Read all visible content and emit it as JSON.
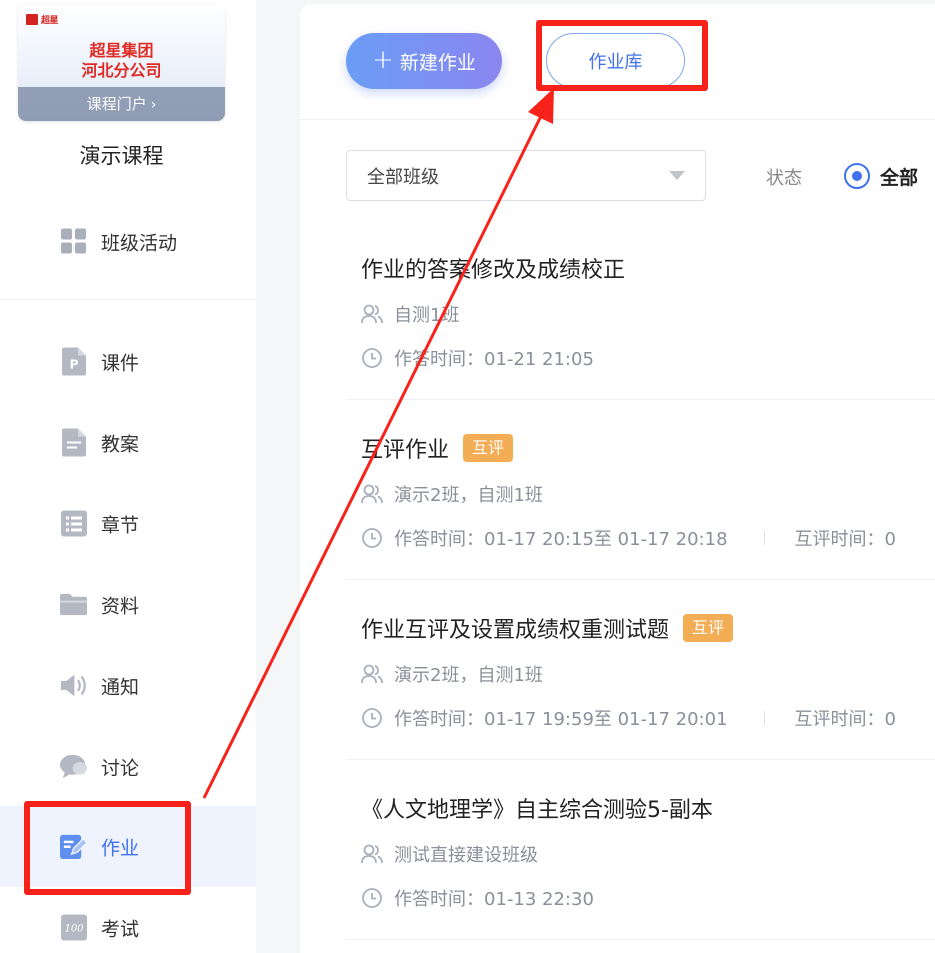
{
  "sidebar": {
    "logo_text": "超星",
    "org_line1": "超星集团",
    "org_line2": "河北分公司",
    "portal_label": "课程门户",
    "course_title": "演示课程",
    "items": [
      {
        "label": "班级活动",
        "icon": "grid-icon"
      },
      {
        "label": "课件",
        "icon": "ppt-file-icon"
      },
      {
        "label": "教案",
        "icon": "lesson-plan-icon"
      },
      {
        "label": "章节",
        "icon": "list-icon"
      },
      {
        "label": "资料",
        "icon": "folder-icon"
      },
      {
        "label": "通知",
        "icon": "speaker-icon"
      },
      {
        "label": "讨论",
        "icon": "chat-bubble-icon"
      },
      {
        "label": "作业",
        "icon": "edit-icon",
        "active": true
      },
      {
        "label": "考试",
        "icon": "score-100-icon"
      }
    ]
  },
  "toolbar": {
    "new_label": "新建作业",
    "library_label": "作业库"
  },
  "filter": {
    "class_selected": "全部班级",
    "status_label": "状态",
    "status_selected": "全部"
  },
  "homework": [
    {
      "title": "作业的答案修改及成绩校正",
      "badge": "",
      "classes": "自测1班",
      "time": "作答时间：01-21 21:05",
      "peer_time": ""
    },
    {
      "title": "互评作业",
      "badge": "互评",
      "classes": "演示2班，自测1班",
      "time": "作答时间：01-17 20:15至 01-17 20:18",
      "peer_time": "互评时间：0"
    },
    {
      "title": "作业互评及设置成绩权重测试题",
      "badge": "互评",
      "classes": "演示2班，自测1班",
      "time": "作答时间：01-17 19:59至 01-17 20:01",
      "peer_time": "互评时间：0"
    },
    {
      "title": "《人文地理学》自主综合测验5-副本",
      "badge": "",
      "classes": "测试直接建设班级",
      "time": "作答时间：01-13 22:30",
      "peer_time": ""
    }
  ],
  "colors": {
    "accent": "#3f72ec",
    "annotation": "#f7231b",
    "badge": "#f2ad55"
  }
}
